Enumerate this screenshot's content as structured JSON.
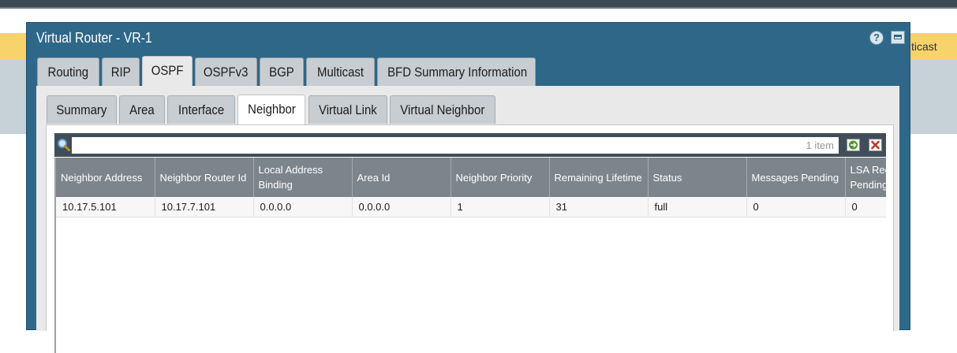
{
  "background": {
    "partial_tab_text": "ticast"
  },
  "dialog": {
    "title": "Virtual Router - VR-1",
    "help_icon": "question-circle-icon",
    "maximize_icon": "window-maximize-icon"
  },
  "tabs": [
    {
      "label": "Routing"
    },
    {
      "label": "RIP"
    },
    {
      "label": "OSPF"
    },
    {
      "label": "OSPFv3"
    },
    {
      "label": "BGP"
    },
    {
      "label": "Multicast"
    },
    {
      "label": "BFD Summary Information"
    }
  ],
  "active_tab": "OSPF",
  "subtabs": [
    {
      "label": "Summary"
    },
    {
      "label": "Area"
    },
    {
      "label": "Interface"
    },
    {
      "label": "Neighbor"
    },
    {
      "label": "Virtual Link"
    },
    {
      "label": "Virtual Neighbor"
    }
  ],
  "active_subtab": "Neighbor",
  "search": {
    "value": "",
    "placeholder": "",
    "count": "1 item",
    "search_icon": "search-icon",
    "apply_icon": "arrow-right-icon",
    "clear_icon": "close-icon"
  },
  "table": {
    "columns": [
      "Neighbor Address",
      "Neighbor Router Id",
      "Local Address Binding",
      "Area Id",
      "Neighbor Priority",
      "Remaining Lifetime",
      "Status",
      "Messages Pending",
      "LSA Request Pending"
    ],
    "rows": [
      [
        "10.17.5.101",
        "10.17.7.101",
        "0.0.0.0",
        "0.0.0.0",
        "1",
        "31",
        "full",
        "0",
        "0"
      ]
    ]
  },
  "colors": {
    "dialog_header": "#2f6789",
    "grid_header": "#7d858c",
    "search_bar": "#3f4e58",
    "clear_icon": "#c0392b",
    "apply_icon": "#4a9a2a"
  }
}
